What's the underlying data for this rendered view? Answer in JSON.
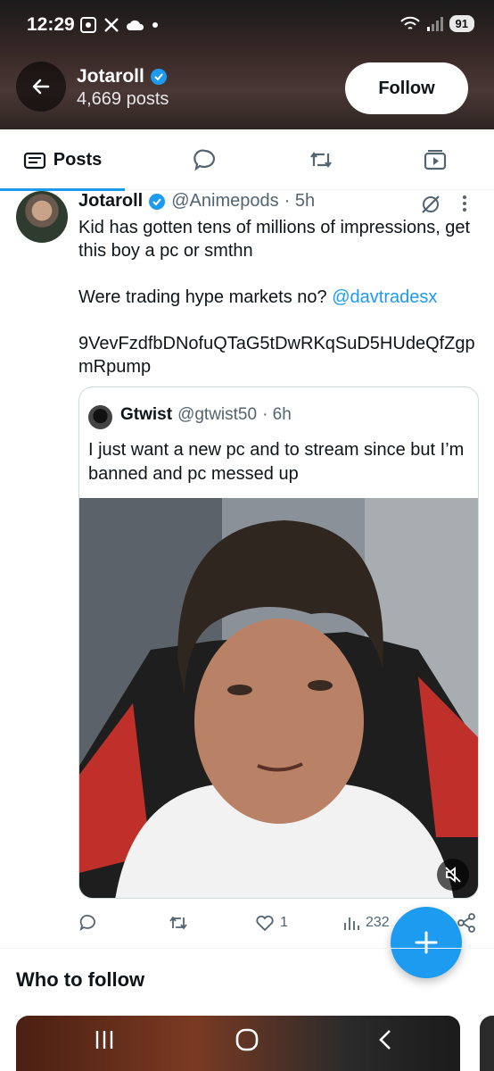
{
  "status_bar": {
    "time": "12:29",
    "battery": "91",
    "icons": [
      "screenshot-icon",
      "x-logo-icon",
      "cloud-icon",
      "dot-icon",
      "wifi-icon",
      "signal-icon"
    ]
  },
  "header": {
    "name": "Jotaroll",
    "posts_count": "4,669 posts",
    "follow_label": "Follow"
  },
  "tabs": {
    "posts_label": "Posts"
  },
  "tweet": {
    "name": "Jotaroll",
    "handle": "@Animepods",
    "time": "· 5h",
    "line1": "Kid has gotten tens of millions of impressions, get this boy a pc or smthn",
    "line2_prefix": "Were trading hype markets no? ",
    "line2_mention": "@davtradesx",
    "line3": "9VevFzdfbDNofuQTaG5tDwRKqSuD5HUdeQfZgpmRpump"
  },
  "quote": {
    "name": "Gtwist",
    "handle": "@gtwist50",
    "time": "· 6h",
    "text": "I just want a new pc and to stream since but I’m banned and pc messed up"
  },
  "actions": {
    "likes": "1",
    "views": "232"
  },
  "who_to_follow": {
    "title": "Who to follow"
  },
  "colors": {
    "accent": "#1d9bf0",
    "secondary_text": "#536471",
    "border": "#cfd9de"
  }
}
